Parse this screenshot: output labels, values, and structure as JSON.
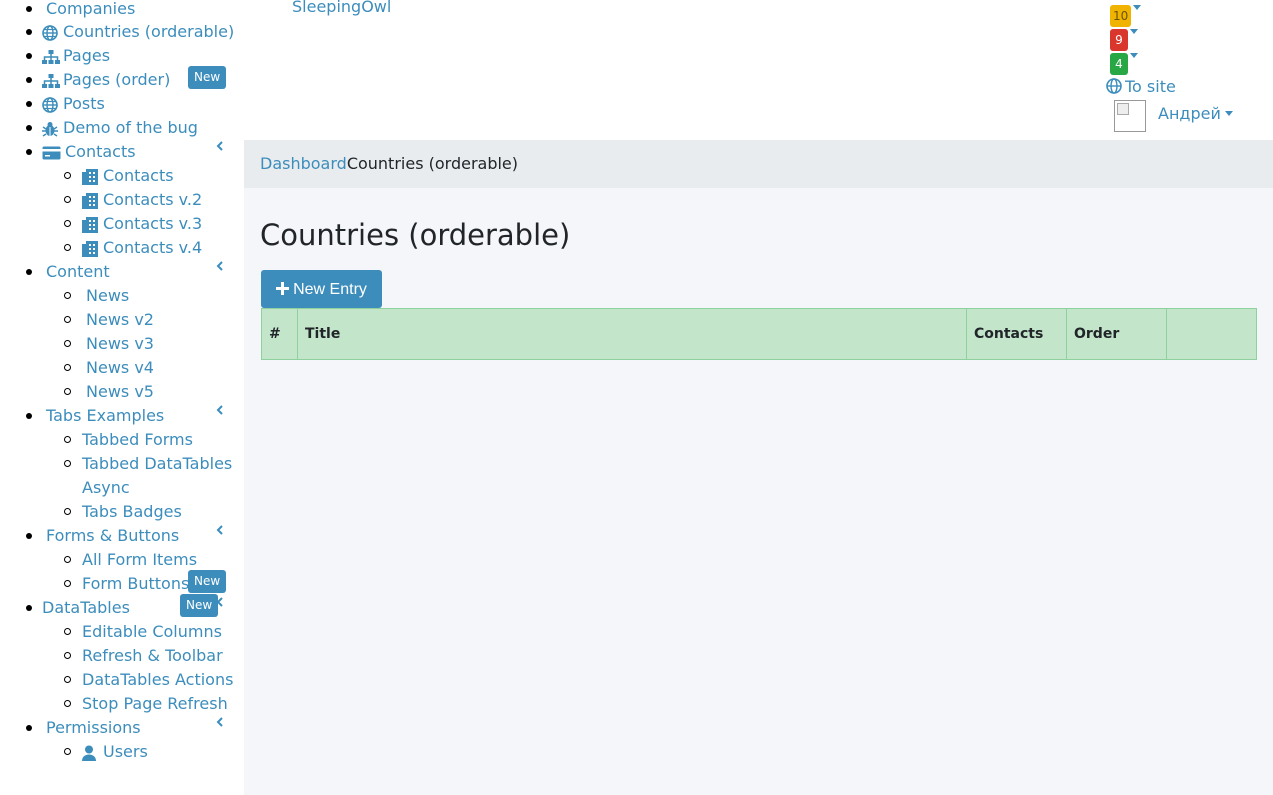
{
  "sidebar": {
    "items": [
      {
        "label": "Companies",
        "icon": "none"
      },
      {
        "label": "Countries (orderable)",
        "icon": "globe-icon"
      },
      {
        "label": "Pages",
        "icon": "sitemap-icon"
      },
      {
        "label": "Pages (order)",
        "icon": "sitemap-icon",
        "badge": "New"
      },
      {
        "label": "Posts",
        "icon": "globe-icon"
      },
      {
        "label": "Demo of the bug",
        "icon": "bug-icon"
      },
      {
        "label": "Contacts",
        "icon": "credit-card-icon"
      },
      {
        "label": "Contacts",
        "icon": "building-icon"
      },
      {
        "label": "Contacts v.2",
        "icon": "building-icon"
      },
      {
        "label": "Contacts v.3",
        "icon": "building-icon"
      },
      {
        "label": "Contacts v.4",
        "icon": "building-icon"
      },
      {
        "label": "Content"
      },
      {
        "label": "News"
      },
      {
        "label": "News v2"
      },
      {
        "label": "News v3"
      },
      {
        "label": "News v4"
      },
      {
        "label": "News v5"
      },
      {
        "label": "Tabs Examples"
      },
      {
        "label": "Tabbed Forms"
      },
      {
        "label": "Tabbed DataTables"
      },
      {
        "label": "Async"
      },
      {
        "label": "Tabs Badges"
      },
      {
        "label": "Forms & Buttons"
      },
      {
        "label": "All Form Items"
      },
      {
        "label": "Form Buttons",
        "badge": "New"
      },
      {
        "label": "DataTables",
        "badge": "New"
      },
      {
        "label": "Editable Columns"
      },
      {
        "label": "Refresh & Toolbar"
      },
      {
        "label": "DataTables Actions"
      },
      {
        "label": "Stop Page Refresh"
      },
      {
        "label": "Permissions"
      },
      {
        "label": "Users",
        "icon": "user-icon"
      }
    ]
  },
  "header": {
    "brand": "SleepingOwl",
    "notifications": [
      {
        "count": "10",
        "color": "#f0b400"
      },
      {
        "count": "9",
        "color": "#d9372b"
      },
      {
        "count": "4",
        "color": "#28a745"
      }
    ],
    "to_site": "To site",
    "user_name": "Андрей"
  },
  "breadcrumb": {
    "home": "Dashboard",
    "current": "Countries (orderable)"
  },
  "main": {
    "title": "Countries (orderable)",
    "new_entry_label": "New Entry",
    "table_headers": [
      "#",
      "Title",
      "Contacts",
      "Order",
      ""
    ]
  },
  "colors": {
    "accent": "#3c8dbc",
    "table_header_bg": "#c3e6cb",
    "content_bg": "#f4f6f9",
    "breadcrumb_bg": "#e9ecef"
  }
}
